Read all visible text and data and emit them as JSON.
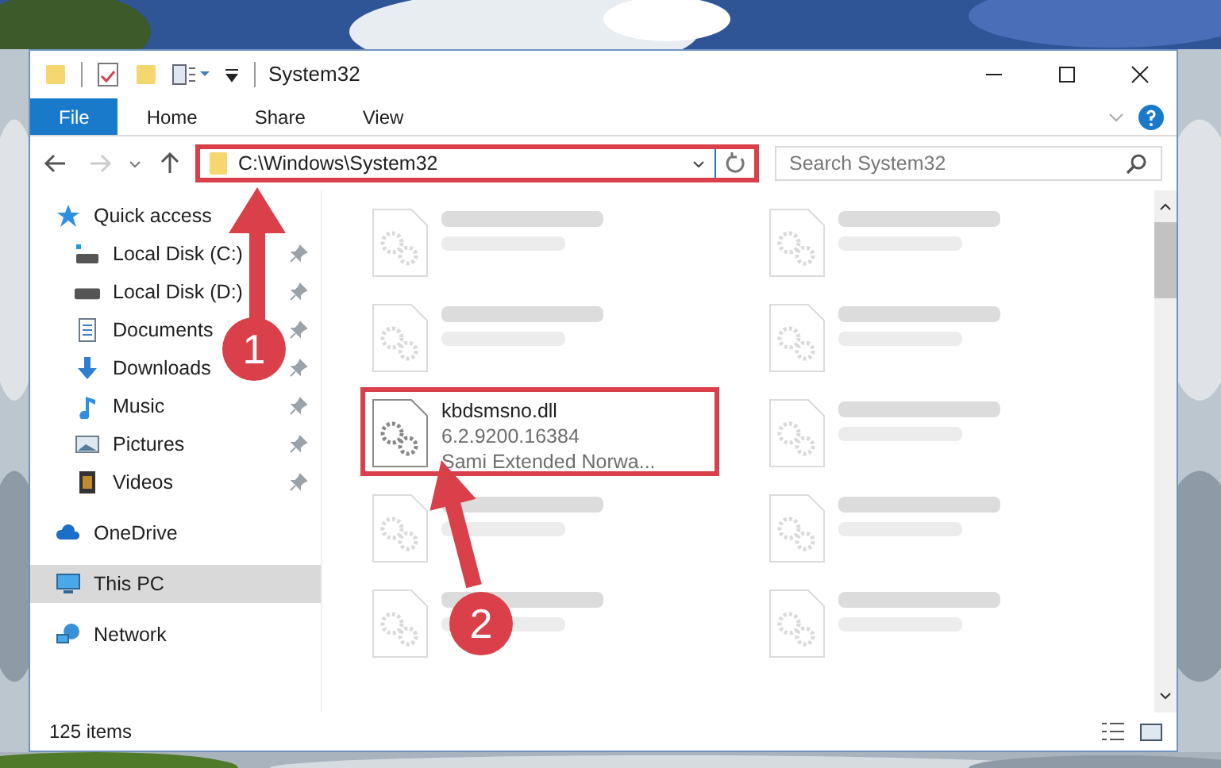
{
  "window": {
    "title": "System32"
  },
  "ribbon_tabs": [
    {
      "label": "File",
      "selected": true
    },
    {
      "label": "Home",
      "selected": false
    },
    {
      "label": "Share",
      "selected": false
    },
    {
      "label": "View",
      "selected": false
    }
  ],
  "address": {
    "value": "C:\\Windows\\System32",
    "highlighted": true
  },
  "search": {
    "placeholder": "Search System32"
  },
  "sidebar": {
    "items": [
      {
        "label": "Quick access",
        "kind": "star",
        "selected": false,
        "children": [
          {
            "label": "Local Disk (C:)",
            "kind": "disk-c",
            "pinned": true,
            "selected": false
          },
          {
            "label": "Local Disk (D:)",
            "kind": "disk",
            "pinned": true,
            "selected": false
          },
          {
            "label": "Documents",
            "kind": "documents",
            "pinned": true,
            "selected": false
          },
          {
            "label": "Downloads",
            "kind": "downloads",
            "pinned": true,
            "selected": false
          },
          {
            "label": "Music",
            "kind": "music",
            "pinned": true,
            "selected": false
          },
          {
            "label": "Pictures",
            "kind": "pictures",
            "pinned": true,
            "selected": false
          },
          {
            "label": "Videos",
            "kind": "videos",
            "pinned": true,
            "selected": false
          }
        ]
      },
      {
        "label": "OneDrive",
        "kind": "cloud",
        "selected": false
      },
      {
        "label": "This PC",
        "kind": "pc",
        "selected": true
      },
      {
        "label": "Network",
        "kind": "network",
        "selected": false
      }
    ]
  },
  "files": [
    {
      "kind": "blurred"
    },
    {
      "kind": "blurred"
    },
    {
      "kind": "blurred"
    },
    {
      "kind": "blurred"
    },
    {
      "kind": "file",
      "lines": [
        "kbdsmsno.dll",
        "6.2.9200.16384",
        "Sami Extended Norwa..."
      ],
      "highlighted": true
    },
    {
      "kind": "blurred"
    },
    {
      "kind": "blurred"
    },
    {
      "kind": "blurred"
    },
    {
      "kind": "blurred"
    },
    {
      "kind": "blurred"
    }
  ],
  "status_bar": {
    "count": "125 items"
  },
  "annotations": [
    {
      "label": "1"
    },
    {
      "label": "2"
    }
  ]
}
